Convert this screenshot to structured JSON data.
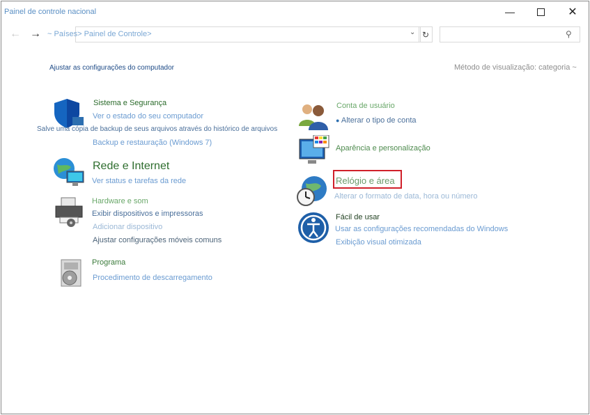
{
  "window": {
    "title": "Painel de controle nacional",
    "minimize_icon": "minimize-icon",
    "maximize_icon": "maximize-icon",
    "close_icon": "close-icon"
  },
  "toolbar": {
    "back_icon": "arrow-left-icon",
    "forward_icon": "arrow-right-icon",
    "address": "~ Países> Painel de Controle>",
    "refresh_icon": "refresh-icon",
    "search_placeholder": "",
    "search_icon": "search-icon"
  },
  "main": {
    "heading": "Ajustar as configurações do computador",
    "view_by": "Método de visualização: categoria ~"
  },
  "categories": {
    "system_security": {
      "title": "Sistema e Segurança",
      "links": [
        "Ver o estado do seu computador",
        "Salve uma cópia de backup de seus arquivos através do histórico de arquivos",
        "Backup e restauração (Windows 7)"
      ]
    },
    "network": {
      "title": "Rede e Internet",
      "links": [
        "Ver status e tarefas da rede"
      ]
    },
    "hardware": {
      "title": "Hardware e som",
      "links": [
        "Exibir dispositivos e impressoras",
        "Adicionar dispositivo",
        "Ajustar configurações móveis comuns"
      ]
    },
    "programs": {
      "title": "Programa",
      "links": [
        "Procedimento de descarregamento"
      ]
    },
    "user_accounts": {
      "title": "Conta de usuário",
      "links": [
        "Alterar o tipo de conta"
      ]
    },
    "appearance": {
      "title": "Aparência e personalização"
    },
    "clock_region": {
      "title": "Relógio e área",
      "links": [
        "Alterar o formato de data, hora ou número"
      ]
    },
    "ease_of_access": {
      "title": "Fácil de usar",
      "links": [
        "Usar as configurações recomendadas do Windows",
        "Exibição visual otimizada"
      ]
    }
  },
  "colors": {
    "highlight_border": "#d0202a",
    "link": "#6a9bd1",
    "category_title": "#2e6d2e"
  }
}
